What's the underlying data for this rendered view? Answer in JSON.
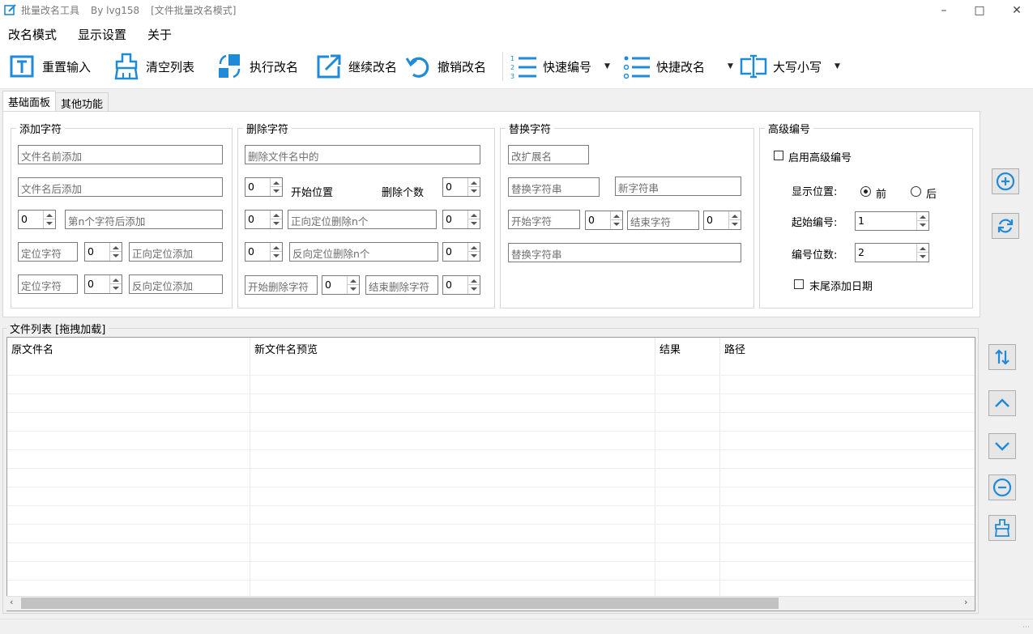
{
  "window": {
    "app_name": "批量改名工具",
    "author": "By lvg158",
    "mode": "[文件批量改名模式]"
  },
  "menu": [
    "改名模式",
    "显示设置",
    "关于"
  ],
  "toolbar": {
    "reset": "重置输入",
    "clear": "清空列表",
    "execute": "执行改名",
    "continue": "继续改名",
    "undo": "撤销改名",
    "quick_number": "快速编号",
    "quick_rename": "快捷改名",
    "case": "大写小写"
  },
  "tabs": [
    "基础面板",
    "其他功能"
  ],
  "add_group": {
    "title": "添加字符",
    "prefix_placeholder": "文件名前添加",
    "suffix_placeholder": "文件名后添加",
    "nth_value": "0",
    "nth_placeholder": "第n个字符后添加",
    "locate1_placeholder": "定位字符",
    "locate1_value": "0",
    "forward_placeholder": "正向定位添加",
    "locate2_placeholder": "定位字符",
    "locate2_value": "0",
    "reverse_placeholder": "反向定位添加"
  },
  "delete_group": {
    "title": "删除字符",
    "in_name_placeholder": "删除文件名中的",
    "start_value": "0",
    "start_label": "开始位置",
    "count_label": "删除个数",
    "count_value": "0",
    "fwd_pos": "0",
    "fwd_placeholder": "正向定位删除n个",
    "fwd_count": "0",
    "rev_pos": "0",
    "rev_placeholder": "反向定位删除n个",
    "rev_count": "0",
    "start_char_placeholder": "开始删除字符",
    "start_char_value": "0",
    "end_char_placeholder": "结束删除字符",
    "end_char_value": "0"
  },
  "replace_group": {
    "title": "替换字符",
    "ext_placeholder": "改扩展名",
    "old_placeholder": "替换字符串",
    "new_placeholder": "新字符串",
    "start_placeholder": "开始字符",
    "start_value": "0",
    "end_placeholder": "结束字符",
    "end_value": "0",
    "replace2_placeholder": "替换字符串"
  },
  "advanced_group": {
    "title": "高级编号",
    "enable_label": "启用高级编号",
    "position_label": "显示位置:",
    "pos_front": "前",
    "pos_back": "后",
    "start_label": "起始编号:",
    "start_value": "1",
    "digits_label": "编号位数:",
    "digits_value": "2",
    "date_label": "末尾添加日期"
  },
  "file_list": {
    "title": "文件列表  [拖拽加载]",
    "columns": [
      "原文件名",
      "新文件名预览",
      "结果",
      "路径"
    ]
  },
  "colors": {
    "accent": "#1f8ad8"
  }
}
